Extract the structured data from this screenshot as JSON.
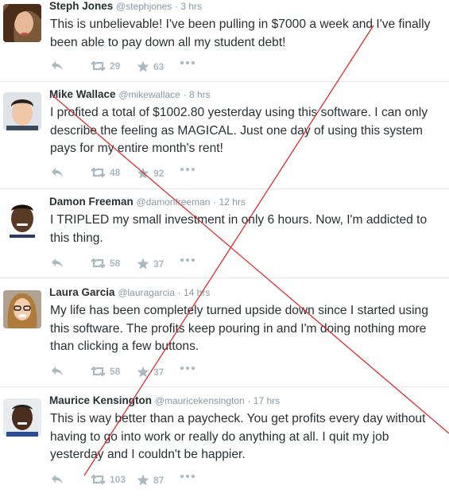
{
  "tweets": [
    {
      "name": "Steph Jones",
      "handle": "@stephjones",
      "time": "· 3 hrs",
      "text": "This is unbelievable! I've been pulling in $7000 a week and I've finally been able to pay down all my student debt!",
      "retweets": "29",
      "favorites": "63"
    },
    {
      "name": "Mike Wallace",
      "handle": "@mikewallace",
      "time": "· 8 hrs",
      "text": "I profited a total of $1002.80 yesterday using this software. I can only describe the feeling as MAGICAL. Just one day of  using this system pays for my entire month's rent!",
      "retweets": "48",
      "favorites": "92"
    },
    {
      "name": "Damon Freeman",
      "handle": "@damonfreeman",
      "time": "· 12 hrs",
      "text": "I TRIPLED my small investment in only 6 hours. Now, I'm addicted to this thing.",
      "retweets": "58",
      "favorites": "37"
    },
    {
      "name": "Laura Garcia",
      "handle": "@lauragarcia",
      "time": "· 14 hrs",
      "text": "My life has been completely turned upside down since I started using this software. The profits keep pouring in and I'm doing nothing more than clicking a few buttons.",
      "retweets": "58",
      "favorites": "37"
    },
    {
      "name": "Maurice Kensington",
      "handle": "@mauricekensington",
      "time": "· 17 hrs",
      "text": "This is way better than a paycheck. You get profits every day without having to go into work or really do anything at all. I quit my job yesterday and I couldn't be happier.",
      "retweets": "103",
      "favorites": "87"
    }
  ],
  "icons": {
    "reply": "reply-icon",
    "retweet": "retweet-icon",
    "favorite": "star-icon",
    "more": "more-icon"
  },
  "colors": {
    "name": "#292f33",
    "muted": "#8899a6",
    "action": "#aab8c2",
    "divider": "#e1e8ed",
    "overlay_x": "#e02020"
  }
}
